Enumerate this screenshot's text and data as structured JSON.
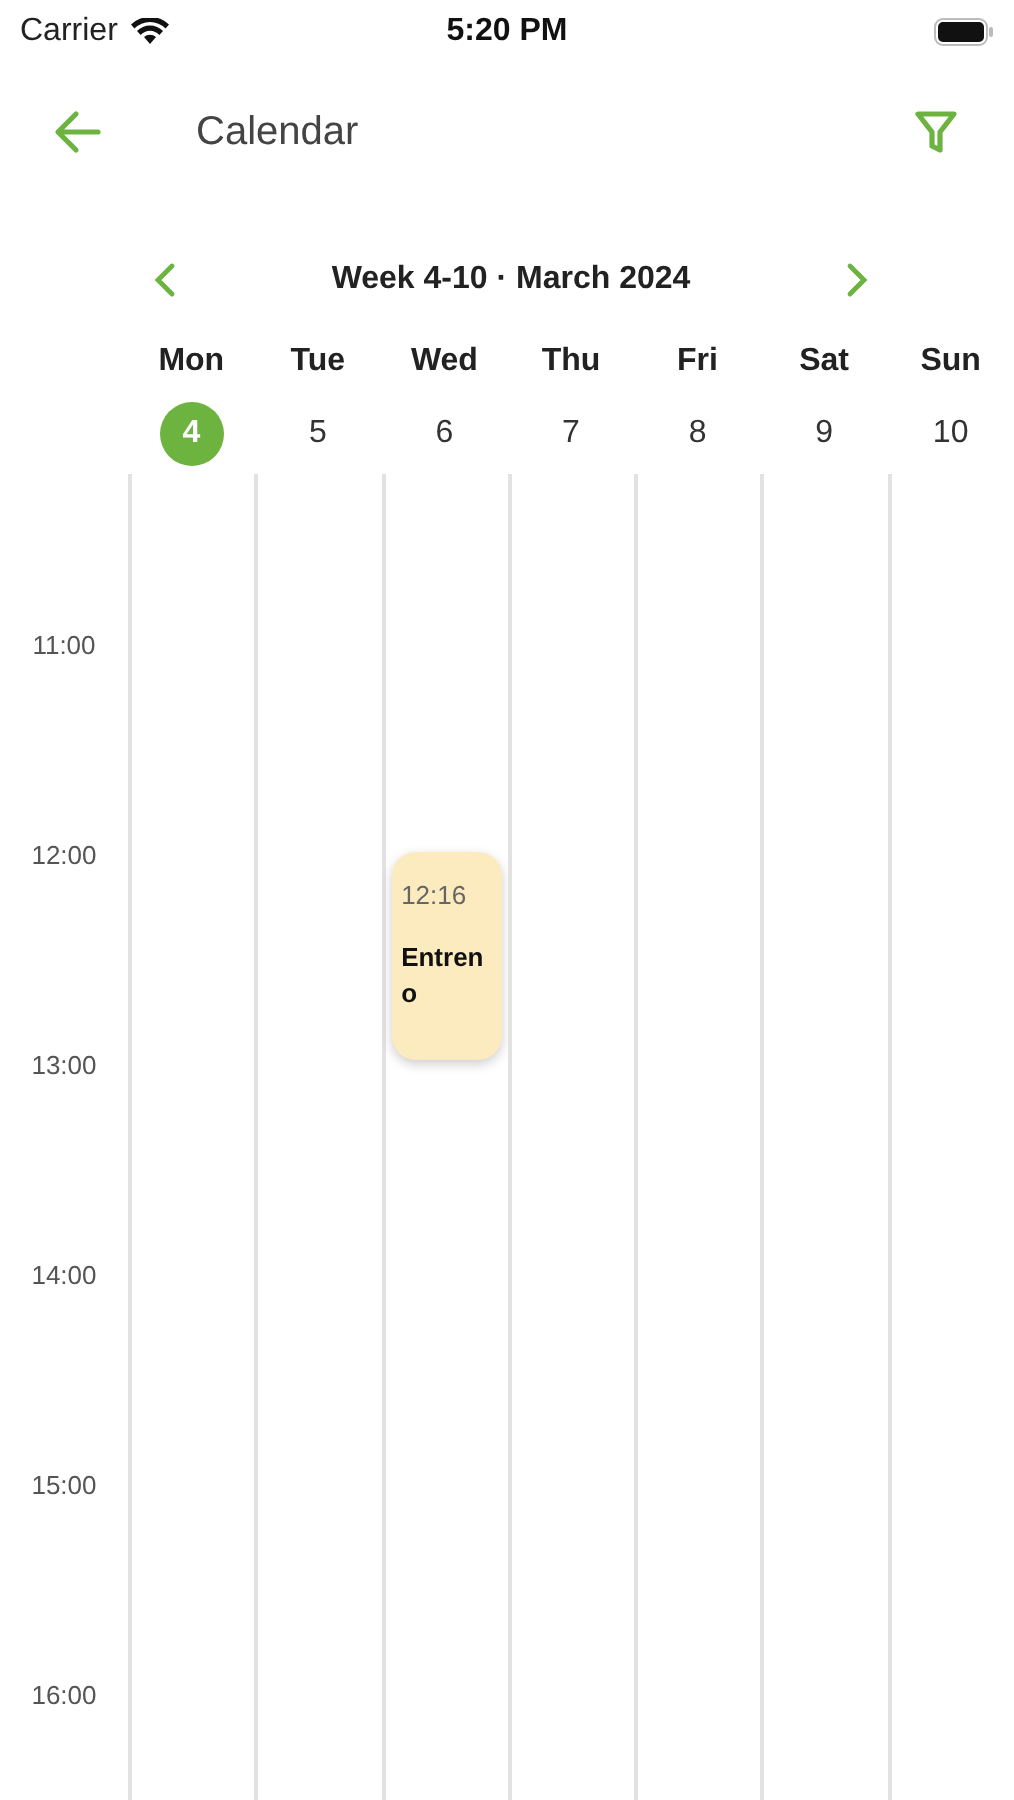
{
  "status_bar": {
    "carrier": "Carrier",
    "time": "5:20 PM"
  },
  "header": {
    "title": "Calendar"
  },
  "week_nav": {
    "label": "Week 4-10 · March 2024"
  },
  "days": [
    {
      "name": "Mon",
      "date": "4",
      "selected": true
    },
    {
      "name": "Tue",
      "date": "5",
      "selected": false
    },
    {
      "name": "Wed",
      "date": "6",
      "selected": false,
      "events": [
        {
          "time": "12:16",
          "title": "Entreno"
        }
      ]
    },
    {
      "name": "Thu",
      "date": "7",
      "selected": false
    },
    {
      "name": "Fri",
      "date": "8",
      "selected": false
    },
    {
      "name": "Sat",
      "date": "9",
      "selected": false
    },
    {
      "name": "Sun",
      "date": "10",
      "selected": false
    }
  ],
  "hours": [
    "11:00",
    "12:00",
    "13:00",
    "14:00",
    "15:00",
    "16:00"
  ]
}
